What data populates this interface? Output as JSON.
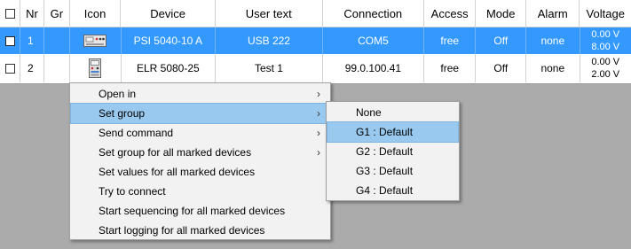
{
  "table": {
    "headers": {
      "nr": "Nr",
      "gr": "Gr",
      "icon": "Icon",
      "device": "Device",
      "user_text": "User text",
      "connection": "Connection",
      "access": "Access",
      "mode": "Mode",
      "alarm": "Alarm",
      "voltage": "Voltage"
    },
    "rows": [
      {
        "nr": "1",
        "gr": "",
        "icon": "power-supply-icon",
        "device": "PSI 5040-10 A",
        "user_text": "USB 222",
        "connection": "COM5",
        "access": "free",
        "mode": "Off",
        "alarm": "none",
        "voltage_1": "0.00 V",
        "voltage_2": "8.00 V",
        "selected": true
      },
      {
        "nr": "2",
        "gr": "",
        "icon": "electronic-load-icon",
        "device": "ELR 5080-25",
        "user_text": "Test 1",
        "connection": "99.0.100.41",
        "access": "free",
        "mode": "Off",
        "alarm": "none",
        "voltage_1": "0.00 V",
        "voltage_2": "2.00 V",
        "selected": false
      }
    ]
  },
  "context_menu": {
    "items": [
      {
        "label": "Open in",
        "submenu": true
      },
      {
        "label": "Set group",
        "submenu": true,
        "highlighted": true
      },
      {
        "label": "Send command",
        "submenu": true
      },
      {
        "label": "Set group for all marked devices",
        "submenu": true
      },
      {
        "label": "Set values for all marked devices",
        "submenu": false
      },
      {
        "label": "Try to connect",
        "submenu": false
      },
      {
        "label": "Start sequencing for all marked devices",
        "submenu": false
      },
      {
        "label": "Start logging for all marked devices",
        "submenu": false
      }
    ],
    "submenu_arrow": "›"
  },
  "group_submenu": {
    "items": [
      {
        "label": "None"
      },
      {
        "label": "G1 : Default",
        "highlighted": true
      },
      {
        "label": "G2 : Default"
      },
      {
        "label": "G3 : Default"
      },
      {
        "label": "G4 : Default"
      }
    ]
  },
  "colors": {
    "selection": "#3399ff",
    "menu_highlight": "#99c9ef",
    "background": "#ababab"
  }
}
